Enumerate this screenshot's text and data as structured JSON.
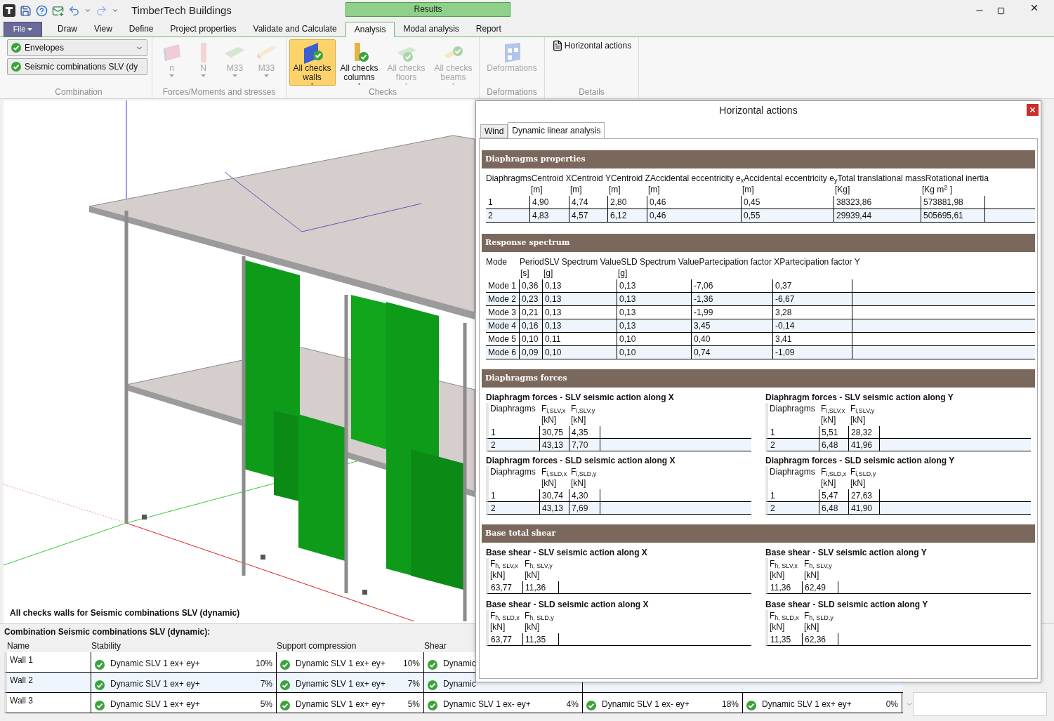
{
  "window": {
    "title": "TimberTech Buildings",
    "context_tab": "Results"
  },
  "menu_tabs": [
    {
      "label": "File",
      "kind": "file",
      "selected": false
    },
    {
      "label": "Draw",
      "kind": "tab",
      "selected": false
    },
    {
      "label": "View",
      "kind": "tab",
      "selected": false
    },
    {
      "label": "Define",
      "kind": "tab",
      "selected": false
    },
    {
      "label": "Project properties",
      "kind": "tab",
      "selected": false
    },
    {
      "label": "Validate and Calculate",
      "kind": "tab",
      "selected": false
    },
    {
      "label": "Analysis",
      "kind": "tab",
      "selected": true
    },
    {
      "label": "Modal analysis",
      "kind": "tab",
      "selected": false
    },
    {
      "label": "Report",
      "kind": "tab",
      "selected": false
    }
  ],
  "ribbon": [
    {
      "label": "Combination",
      "kind": "selectors",
      "items": [
        {
          "label": "Envelopes"
        },
        {
          "label": "Seismic combinations SLV (dy"
        }
      ]
    },
    {
      "label": "Forces/Moments and stresses",
      "kind": "large",
      "items": [
        {
          "label": "n",
          "disabled": true,
          "selected": false,
          "dropdown": true
        },
        {
          "label": "N",
          "disabled": true,
          "selected": false,
          "dropdown": true
        },
        {
          "label": "M33",
          "disabled": true,
          "selected": false,
          "dropdown": true
        },
        {
          "label": "M33",
          "disabled": true,
          "selected": false,
          "dropdown": true
        }
      ]
    },
    {
      "label": "Checks",
      "kind": "large",
      "items": [
        {
          "label": "All checks walls",
          "disabled": false,
          "selected": true,
          "dropdown": true
        },
        {
          "label": "All checks columns",
          "disabled": false,
          "selected": false,
          "dropdown": true
        },
        {
          "label": "All checks floors",
          "disabled": true,
          "selected": false,
          "dropdown": true
        },
        {
          "label": "All checks beams",
          "disabled": true,
          "selected": false,
          "dropdown": true
        }
      ]
    },
    {
      "label": "Deformations",
      "kind": "large",
      "items": [
        {
          "label": "Deformations",
          "disabled": true,
          "selected": false
        }
      ]
    },
    {
      "label": "Details",
      "kind": "small",
      "items": [
        {
          "label": "Horizontal actions"
        }
      ]
    }
  ],
  "viewport": {
    "caption": "All checks walls for Seismic combinations SLV (dynamic)"
  },
  "results_table": {
    "title": "Combination Seismic combinations SLV (dynamic):",
    "columns": [
      "Name",
      "Stability",
      "Support compression",
      "Shear"
    ],
    "rows": [
      {
        "cells": [
          {
            "kind": "name",
            "text": "Wall 1"
          },
          {
            "kind": "check",
            "text": "Dynamic SLV 1 ex+ ey+",
            "percent": "10%",
            "passed": true
          },
          {
            "kind": "check",
            "text": "Dynamic SLV 1 ex+ ey+",
            "percent": "10%",
            "passed": true
          },
          {
            "kind": "check",
            "text": "Dynamic",
            "passed": true
          }
        ]
      },
      {
        "cells": [
          {
            "kind": "name",
            "text": "Wall 2"
          },
          {
            "kind": "check",
            "text": "Dynamic SLV 1 ex+ ey+",
            "percent": "7%",
            "passed": true
          },
          {
            "kind": "check",
            "text": "Dynamic SLV 1 ex+ ey+",
            "percent": "7%",
            "passed": true
          },
          {
            "kind": "check",
            "text": "Dynamic",
            "passed": true
          }
        ]
      },
      {
        "cells": [
          {
            "kind": "name",
            "text": "Wall 3"
          },
          {
            "kind": "check",
            "text": "Dynamic SLV 1 ex+ ey+",
            "percent": "5%",
            "passed": true
          },
          {
            "kind": "check",
            "text": "Dynamic SLV 1 ex+ ey+",
            "percent": "5%",
            "passed": true
          },
          {
            "kind": "check",
            "text": "Dynamic SLV 1 ex- ey+",
            "percent": "4%",
            "passed": true
          },
          {
            "kind": "check",
            "text": "Dynamic SLV 1 ex- ey+",
            "percent": "18%",
            "passed": true
          },
          {
            "kind": "check",
            "text": "Dynamic SLV 1 ex+ ey+",
            "percent": "0%",
            "passed": true
          }
        ]
      }
    ]
  },
  "panel": {
    "title": "Horizontal actions",
    "tabs": [
      {
        "label": "Wind",
        "selected": false
      },
      {
        "label": "Dynamic linear analysis",
        "selected": true
      }
    ],
    "diaphragms_properties": {
      "title": "Diaphragms properties",
      "headers": [
        "Diaphragms",
        "Centroid X",
        "Centroid Y",
        "Centroid Z",
        "Accidental eccentricity e$_{x}$",
        "Accidental eccentricity e$_{y}$",
        "Total translational mass",
        "Rotational inertia"
      ],
      "units": [
        "[m]",
        "[m]",
        "[m]",
        "[m]",
        "[m]",
        "[Kg]",
        "[Kg m$^{2}$ ]"
      ],
      "rows": [
        [
          "1",
          "4,90",
          "4,74",
          "2,80",
          "0,46",
          "0,45",
          "38323,86",
          "573881,98"
        ],
        [
          "2",
          "4,83",
          "4,57",
          "6,12",
          "0,46",
          "0,55",
          "29939,44",
          "505695,61"
        ]
      ]
    },
    "response_spectrum": {
      "title": "Response spectrum",
      "headers": [
        "Mode",
        "Period",
        "SLV Spectrum Value",
        "SLD Spectrum Value",
        "Partecipation factor X",
        "Partecipation factor Y"
      ],
      "units": [
        "[s]",
        "[g]",
        "[g]"
      ],
      "rows": [
        [
          "Mode 1",
          "0,36",
          "0,13",
          "0,13",
          "-7,06",
          "0,37"
        ],
        [
          "Mode 2",
          "0,23",
          "0,13",
          "0,13",
          "-1,36",
          "-6,67"
        ],
        [
          "Mode 3",
          "0,21",
          "0,13",
          "0,13",
          "-1,99",
          "3,28"
        ],
        [
          "Mode 4",
          "0,16",
          "0,13",
          "0,13",
          "3,45",
          "-0,14"
        ],
        [
          "Mode 5",
          "0,10",
          "0,11",
          "0,10",
          "0,40",
          "3,41"
        ],
        [
          "Mode 6",
          "0,09",
          "0,10",
          "0,10",
          "0,74",
          "-1,09"
        ]
      ]
    },
    "diaphragms_forces": {
      "title": "Diaphragms forces",
      "tables": [
        {
          "title": "Diaphragm forces - SLV seismic action along X",
          "headers": [
            "Diaphragms",
            "F$_{i,SLV,x}$",
            "F$_{i,SLV,y}$"
          ],
          "units": [
            "[kN]",
            "[kN]"
          ],
          "rows": [
            [
              "1",
              "30,75",
              "4,35"
            ],
            [
              "2",
              "43,13",
              "7,70"
            ]
          ]
        },
        {
          "title": "Diaphragm forces - SLV seismic action along Y",
          "headers": [
            "Diaphragms",
            "F$_{i,SLV,x}$",
            "F$_{i,SLV,y}$"
          ],
          "units": [
            "[kN]",
            "[kN]"
          ],
          "rows": [
            [
              "1",
              "5,51",
              "28,32"
            ],
            [
              "2",
              "6,48",
              "41,96"
            ]
          ]
        },
        {
          "title": "Diaphragm forces - SLD seismic action along X",
          "headers": [
            "Diaphragms",
            "F$_{i,SLD,x}$",
            "F$_{i,SLD,y}$"
          ],
          "units": [
            "[kN]",
            "[kN]"
          ],
          "rows": [
            [
              "1",
              "30,74",
              "4,30"
            ],
            [
              "2",
              "43,13",
              "7,69"
            ]
          ]
        },
        {
          "title": "Diaphragm forces - SLD seismic action along Y",
          "headers": [
            "Diaphragms",
            "F$_{i,SLD,x}$",
            "F$_{i,SLD,y}$"
          ],
          "units": [
            "[kN]",
            "[kN]"
          ],
          "rows": [
            [
              "1",
              "5,47",
              "27,63"
            ],
            [
              "2",
              "6,48",
              "41,90"
            ]
          ]
        }
      ]
    },
    "base_total_shear": {
      "title": "Base total shear",
      "tables": [
        {
          "title": "Base shear - SLV seismic action along X",
          "headers": [
            "F$_{h, SLV,x}$",
            "F$_{h, SLV,y}$"
          ],
          "units": [
            "[kN]",
            "[kN]"
          ],
          "rows": [
            [
              "63,77",
              "11,36"
            ]
          ]
        },
        {
          "title": "Base shear - SLV seismic action along Y",
          "headers": [
            "F$_{h, SLV,x}$",
            "F$_{h, SLV,y}$"
          ],
          "units": [
            "[kN]",
            "[kN]"
          ],
          "rows": [
            [
              "11,36",
              "62,49"
            ]
          ]
        },
        {
          "title": "Base shear - SLD seismic action along X",
          "headers": [
            "F$_{h, SLD,x}$",
            "F$_{h, SLD,y}$"
          ],
          "units": [
            "[kN]",
            "[kN]"
          ],
          "rows": [
            [
              "63,77",
              "11,35"
            ]
          ]
        },
        {
          "title": "Base shear - SLD seismic action along Y",
          "headers": [
            "F$_{h, SLD,x}$",
            "F$_{h, SLD,y}$"
          ],
          "units": [
            "[kN]",
            "[kN]"
          ],
          "rows": [
            [
              "11,35",
              "62,36"
            ]
          ]
        }
      ]
    }
  }
}
